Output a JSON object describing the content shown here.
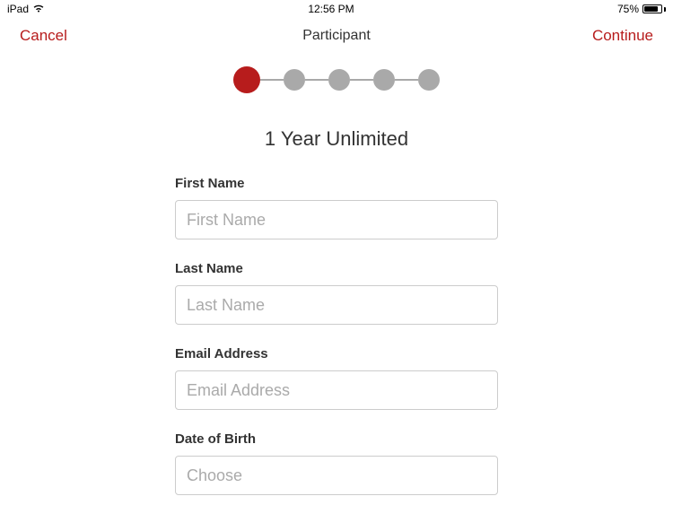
{
  "status_bar": {
    "device": "iPad",
    "time": "12:56 PM",
    "battery_percent": "75%"
  },
  "nav": {
    "cancel": "Cancel",
    "title": "Participant",
    "continue": "Continue"
  },
  "stepper": {
    "total": 5,
    "current": 1
  },
  "subtitle": "1 Year Unlimited",
  "form": {
    "first_name": {
      "label": "First Name",
      "placeholder": "First Name",
      "value": ""
    },
    "last_name": {
      "label": "Last Name",
      "placeholder": "Last Name",
      "value": ""
    },
    "email": {
      "label": "Email Address",
      "placeholder": "Email Address",
      "value": ""
    },
    "dob": {
      "label": "Date of Birth",
      "placeholder": "Choose",
      "value": ""
    }
  }
}
